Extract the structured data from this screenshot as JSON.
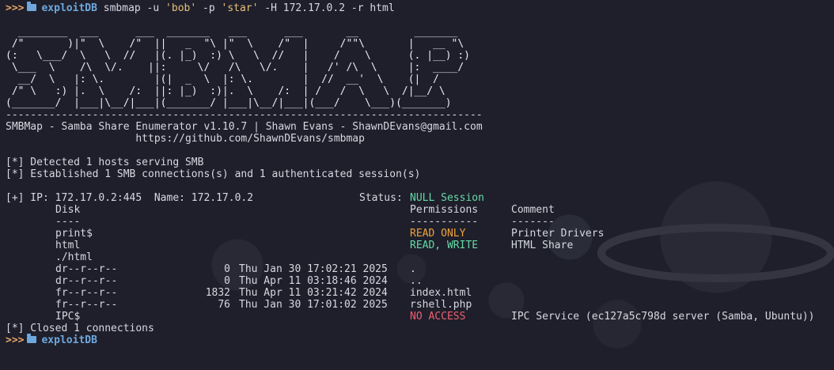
{
  "prompt": {
    "arrows": ">>>",
    "directory": "exploitDB",
    "command": "smbmap -u 'bob' -p 'star' -H 172.17.0.2 -r html",
    "cmd_part1": "smbmap -u ",
    "cmd_str1": "'bob'",
    "cmd_part2": " -p ",
    "cmd_str2": "'star'",
    "cmd_part3": " -H 172.17.0.2 -r html"
  },
  "banner": {
    "art": [
      "  ________  ___      ___  _______   ___      ___       __         _______",
      " /\"       )|\"  \\    /\"  ||   _  \"\\ |\"  \\    /\"  |     /\"\"\\       |   __ \"\\",
      "(:   \\___/  \\   \\  //   |(. |_)  :) \\   \\  //   |    /    \\      (. |__) :)",
      " \\___  \\    /\\  \\/.    ||:     \\/   /\\   \\/.    |   /' /\\  \\     |:  ____/",
      "  __/  \\   |: \\.        |(|  _  \\  |: \\.        |  //  __'  \\    (|  /",
      " /\" \\   :) |.  \\    /:  ||: |_)  :)|.  \\    /:  | /   /  \\   \\  /|__/ \\",
      "(_______/  |___|\\__/|___|(_______/ |___|\\__/|___|(___/    \\___)(_______)"
    ],
    "separator": "-----------------------------------------------------------------------------",
    "info": "SMBMap - Samba Share Enumerator v1.10.7 | Shawn Evans - ShawnDEvans@gmail.com",
    "url": "                     https://github.com/ShawnDEvans/smbmap"
  },
  "messages": {
    "detected": "[*] Detected 1 hosts serving SMB",
    "established": "[*] Established 1 SMB connections(s) and 1 authenticated session(s)",
    "closed": "[*] Closed 1 connections"
  },
  "host": {
    "prefix": "[+] IP: 172.17.0.2:445  Name: 172.17.0.2",
    "status_label": "Status: ",
    "status_value": "NULL Session"
  },
  "shares_header": {
    "disk": "Disk",
    "permissions": "Permissions",
    "comment": "Comment",
    "disk_rule": "----",
    "perm_rule": "-----------",
    "comment_rule": "-------"
  },
  "shares": [
    {
      "name": "print$",
      "permissions": "READ ONLY",
      "perm_color": "orange",
      "comment": "Printer Drivers"
    },
    {
      "name": "html",
      "permissions": "READ, WRITE",
      "perm_color": "green",
      "comment": "HTML Share"
    }
  ],
  "listing_path": "./html",
  "files": [
    {
      "mode": "dr--r--r--",
      "size": "0",
      "date": "Thu Jan 30 17:02:21 2025",
      "name": "."
    },
    {
      "mode": "dr--r--r--",
      "size": "0",
      "date": "Thu Apr 11 03:18:46 2024",
      "name": ".."
    },
    {
      "mode": "fr--r--r--",
      "size": "1832",
      "date": "Thu Apr 11 03:21:42 2024",
      "name": "index.html"
    },
    {
      "mode": "fr--r--r--",
      "size": "76",
      "date": "Thu Jan 30 17:01:02 2025",
      "name": "rshell.php"
    }
  ],
  "ipc_share": {
    "name": "IPC$",
    "permissions": "NO ACCESS",
    "comment": "IPC Service (ec127a5c798d server (Samba, Ubuntu))"
  },
  "colors": {
    "background": "#1e1f2b",
    "text": "#d7d8e0",
    "prompt_arrows": "#e8a468",
    "directory": "#6fa8dc",
    "string": "#e6c07b",
    "green": "#66d9a6",
    "orange": "#f0a23a",
    "red": "#f05f6f"
  }
}
